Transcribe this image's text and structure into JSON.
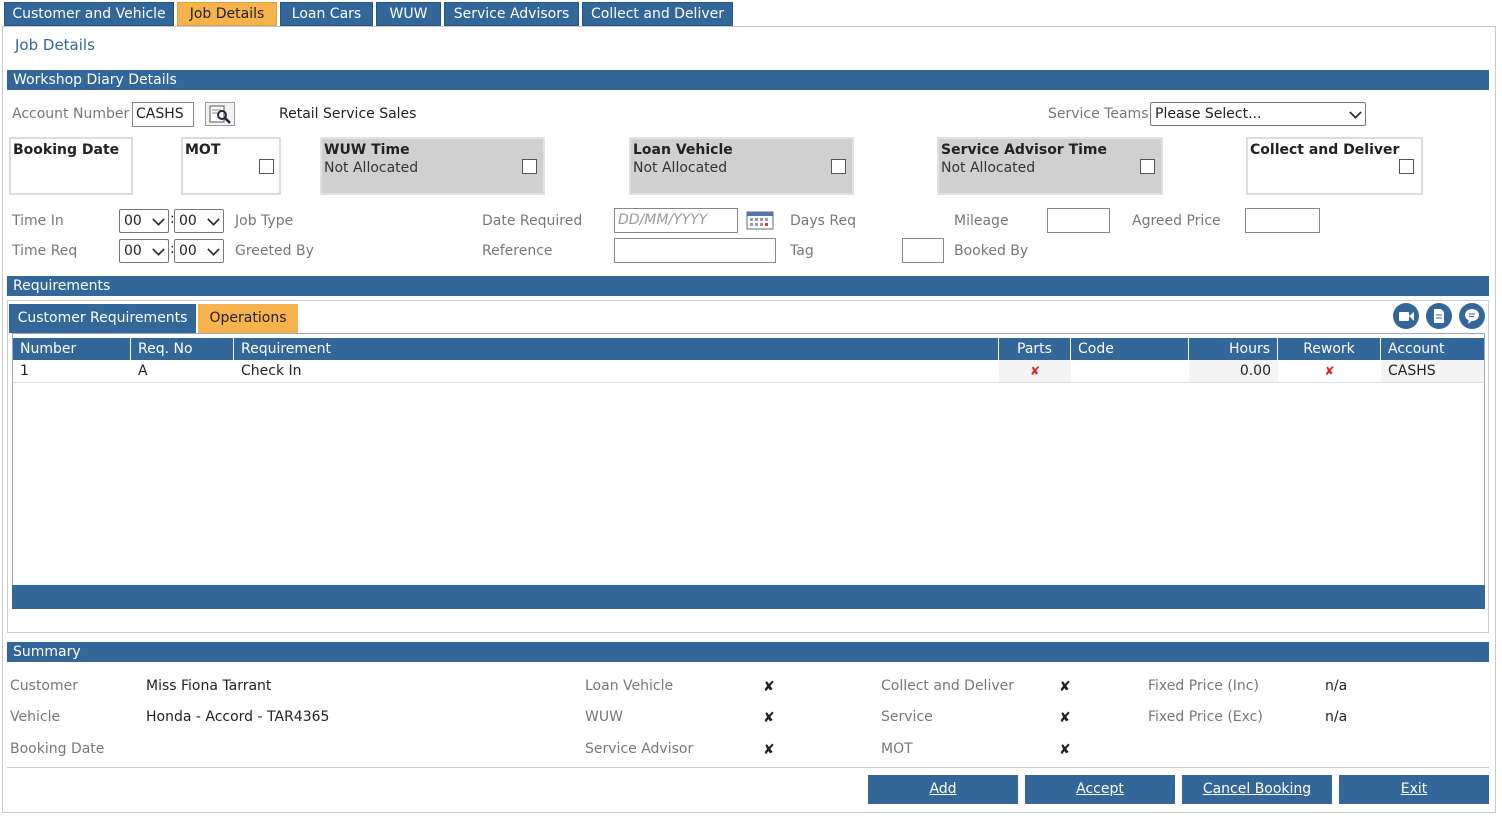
{
  "tabs": [
    "Customer and Vehicle",
    "Job Details",
    "Loan Cars",
    "WUW",
    "Service Advisors",
    "Collect and Deliver"
  ],
  "page_title": "Job Details",
  "workshop": {
    "section_title": "Workshop Diary Details",
    "account_label": "Account Number",
    "account_value": "CASHS",
    "account_name": "Retail Service Sales",
    "service_teams_label": "Service Teams",
    "service_teams_value": "Please Select..."
  },
  "cards": {
    "booking_date": "Booking Date",
    "mot": "MOT",
    "wuw_time": "WUW Time",
    "wuw_status": "Not Allocated",
    "loan_vehicle": "Loan Vehicle",
    "loan_status": "Not Allocated",
    "advisor_time": "Service Advisor Time",
    "advisor_status": "Not Allocated",
    "collect_deliver": "Collect and Deliver"
  },
  "fields": {
    "time_in": "Time In",
    "time_req": "Time Req",
    "hour_value": "00",
    "minute_value": "00",
    "job_type": "Job Type",
    "greeted_by": "Greeted By",
    "date_required": "Date Required",
    "date_placeholder": "DD/MM/YYYY",
    "reference": "Reference",
    "days_req": "Days Req",
    "tag": "Tag",
    "mileage": "Mileage",
    "booked_by": "Booked By",
    "agreed_price": "Agreed Price"
  },
  "requirements": {
    "section_title": "Requirements",
    "subtabs": [
      "Customer Requirements",
      "Operations"
    ],
    "columns": [
      "Number",
      "Req. No",
      "Requirement",
      "Parts",
      "Code",
      "Hours",
      "Rework",
      "Account"
    ],
    "rows": [
      {
        "number": "1",
        "req_no": "A",
        "requirement": "Check In",
        "parts": "✘",
        "code": "",
        "hours": "0.00",
        "rework": "✘",
        "account": "CASHS"
      }
    ]
  },
  "summary": {
    "section_title": "Summary",
    "customer_label": "Customer",
    "customer_value": "Miss Fiona Tarrant",
    "vehicle_label": "Vehicle",
    "vehicle_value": "Honda - Accord - TAR4365",
    "booking_date_label": "Booking Date",
    "loan_vehicle_label": "Loan Vehicle",
    "wuw_label": "WUW",
    "service_advisor_label": "Service Advisor",
    "collect_deliver_label": "Collect and Deliver",
    "service_label": "Service",
    "mot_label": "MOT",
    "fixed_inc_label": "Fixed Price (Inc)",
    "fixed_inc_value": "n/a",
    "fixed_exc_label": "Fixed Price (Exc)",
    "fixed_exc_value": "n/a",
    "cross": "✘"
  },
  "buttons": {
    "add": "Add",
    "accept": "Accept",
    "cancel": "Cancel Booking",
    "exit": "Exit"
  },
  "colors": {
    "primary": "#336699",
    "active_tab": "#f6b24d",
    "status_cross": "#dd2222"
  }
}
